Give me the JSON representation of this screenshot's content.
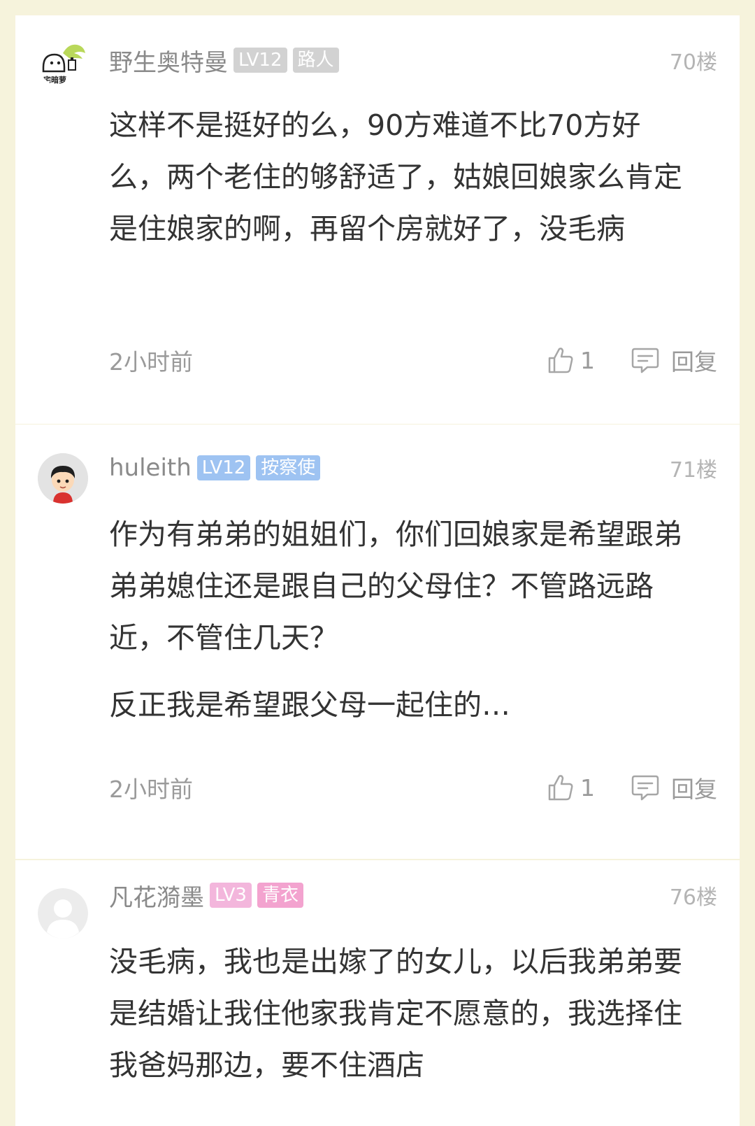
{
  "comments": [
    {
      "username": "野生奥特曼",
      "level": "LV12",
      "title": "路人",
      "floor": "70楼",
      "paragraphs": [
        "这样不是挺好的么，90方难道不比70方好么，两个老住的够舒适了，姑娘回娘家么肯定是住娘家的啊，再留个房就好了，没毛病"
      ],
      "time": "2小时前",
      "likes": "1",
      "reply_label": "回复",
      "avatar_text": "宅暗萝",
      "level_color": "#d2d2d2",
      "title_color": "#d2d2d2"
    },
    {
      "username": "huleith",
      "level": "LV12",
      "title": "按察使",
      "floor": "71楼",
      "paragraphs": [
        "作为有弟弟的姐姐们，你们回娘家是希望跟弟弟弟媳住还是跟自己的父母住？不管路远路近，不管住几天？",
        "反正我是希望跟父母一起住的…"
      ],
      "time": "2小时前",
      "likes": "1",
      "reply_label": "回复",
      "level_color": "#9ec3f2",
      "title_color": "#9ec3f2"
    },
    {
      "username": "凡花漪墨",
      "level": "LV3",
      "title": "青衣",
      "floor": "76楼",
      "paragraphs": [
        "没毛病，我也是出嫁了的女儿，以后我弟弟要是结婚让我住他家我肯定不愿意的，我选择住我爸妈那边，要不住酒店"
      ],
      "level_color": "#f3b6dc",
      "title_color": "#f3a3cf"
    }
  ]
}
